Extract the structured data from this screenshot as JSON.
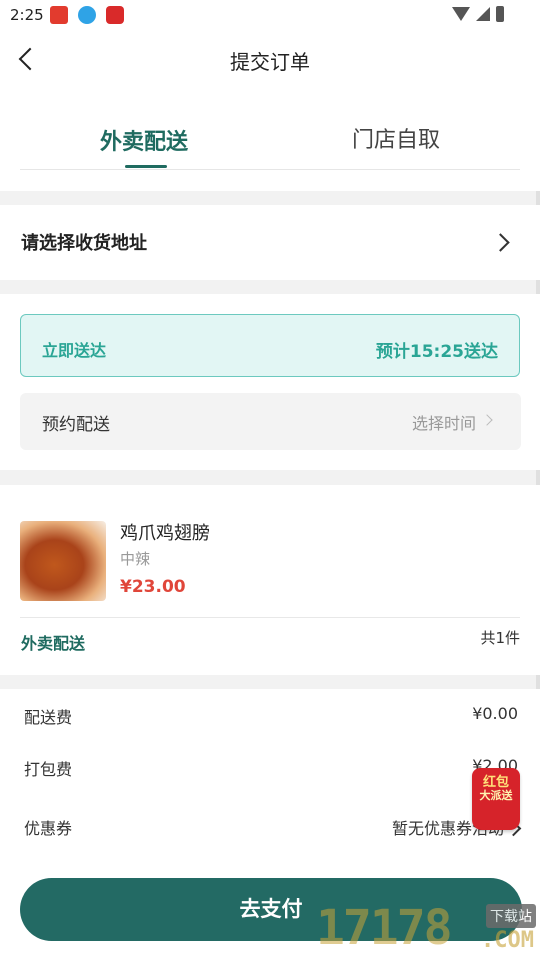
{
  "status_bar": {
    "time": "2:25",
    "icons": [
      "app-red-envelope-icon",
      "download-icon",
      "app-red-icon",
      "wifi-icon",
      "signal-icon",
      "battery-icon"
    ]
  },
  "header": {
    "title": "提交订单",
    "back_icon": "back-arrow-icon"
  },
  "tabs": [
    {
      "label": "外卖配送",
      "active": true
    },
    {
      "label": "门店自取",
      "active": false
    }
  ],
  "address": {
    "label": "请选择收货地址"
  },
  "delivery": {
    "instant_label": "立即送达",
    "eta": "预计15:25送达",
    "schedule_label": "预约配送",
    "schedule_value": "选择时间"
  },
  "product": {
    "name": "鸡爪鸡翅膀",
    "spec": "中辣",
    "price": "¥23.00",
    "mode": "外卖配送",
    "count": "共1件"
  },
  "fees": [
    {
      "label": "配送费",
      "value": "¥0.00"
    },
    {
      "label": "打包费",
      "value": "¥2.00"
    },
    {
      "label": "优惠券",
      "value": "暂无优惠券活动"
    }
  ],
  "pay_button": "去支付",
  "promo": {
    "line1": "红包",
    "line2": "大派送"
  },
  "watermark": {
    "digits": "17178",
    "tag": "下载站",
    "suffix": ".COM"
  },
  "colors": {
    "accent": "#1f6b60",
    "button": "#236a64",
    "instant_bg": "#e2f6f4",
    "instant_text": "#2aa595",
    "price": "#e0463a"
  }
}
